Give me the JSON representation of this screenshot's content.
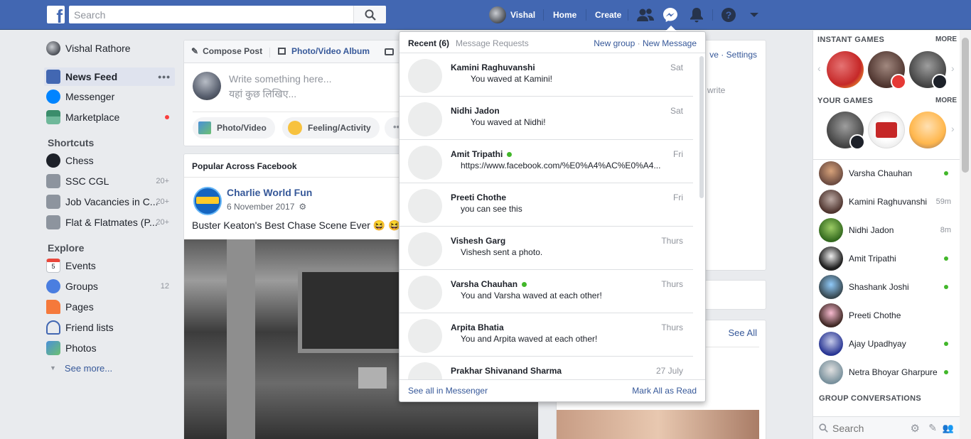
{
  "topbar": {
    "search_placeholder": "Search",
    "user_name": "Vishal",
    "home_label": "Home",
    "create_label": "Create"
  },
  "sidebar": {
    "profile_name": "Vishal Rathore",
    "main_items": [
      {
        "label": "News Feed",
        "icon": "news-feed-icon"
      },
      {
        "label": "Messenger",
        "icon": "messenger-icon"
      },
      {
        "label": "Marketplace",
        "icon": "marketplace-icon"
      }
    ],
    "shortcuts_title": "Shortcuts",
    "shortcuts": [
      {
        "label": "Chess",
        "count": ""
      },
      {
        "label": "SSC CGL",
        "count": "20+"
      },
      {
        "label": "Job Vacancies in C...",
        "count": "20+"
      },
      {
        "label": "Flat & Flatmates (P...",
        "count": "20+"
      }
    ],
    "explore_title": "Explore",
    "explore": [
      {
        "label": "Events",
        "count": ""
      },
      {
        "label": "Groups",
        "count": "12"
      },
      {
        "label": "Pages",
        "count": ""
      },
      {
        "label": "Friend lists",
        "count": ""
      },
      {
        "label": "Photos",
        "count": ""
      }
    ],
    "see_more": "See more..."
  },
  "composer": {
    "tab_compose": "Compose Post",
    "tab_album": "Photo/Video Album",
    "placeholder_en": "Write something here...",
    "placeholder_hi": "यहां कुछ लिखिए...",
    "btn_photo": "Photo/Video",
    "btn_feeling": "Feeling/Activity"
  },
  "feed": {
    "section_title": "Popular Across Facebook",
    "page_name": "Charlie World Fun",
    "post_date": "6 November 2017",
    "post_text": "Buster Keaton's Best Chase Scene Ever 😆 😆"
  },
  "right_partial": {
    "line1": "ve · Settings",
    "line2": "write",
    "see_all": "See All"
  },
  "messenger": {
    "tab_recent": "Recent",
    "recent_count": "(6)",
    "tab_requests": "Message Requests",
    "new_group": "New group",
    "dot": "·",
    "new_message": "New Message",
    "see_all": "See all in Messenger",
    "mark_all": "Mark All as Read",
    "messages": [
      {
        "name": "Kamini Raghuvanshi",
        "text": "You waved at Kamini!",
        "time": "Sat",
        "online": false,
        "indent": true
      },
      {
        "name": "Nidhi Jadon",
        "text": "You waved at Nidhi!",
        "time": "Sat",
        "online": false,
        "indent": true
      },
      {
        "name": "Amit Tripathi",
        "text": "https://www.facebook.com/%E0%A4%AC%E0%A4...",
        "time": "Fri",
        "online": true,
        "indent": false
      },
      {
        "name": "Preeti Chothe",
        "text": "you can see this",
        "time": "Fri",
        "online": false,
        "indent": false
      },
      {
        "name": "Vishesh Garg",
        "text": "Vishesh sent a photo.",
        "time": "Thurs",
        "online": false,
        "indent": false
      },
      {
        "name": "Varsha Chauhan",
        "text": "You and Varsha waved at each other!",
        "time": "Thurs",
        "online": true,
        "indent": false
      },
      {
        "name": "Arpita Bhatia",
        "text": "You and Arpita waved at each other!",
        "time": "Thurs",
        "online": false,
        "indent": false
      },
      {
        "name": "Prakhar Shivanand Sharma",
        "text": "",
        "time": "27 July",
        "online": false,
        "indent": false
      }
    ]
  },
  "chat": {
    "instant_games": "INSTANT GAMES",
    "your_games": "YOUR GAMES",
    "more": "MORE",
    "group_conversations": "GROUP CONVERSATIONS",
    "search_placeholder": "Search",
    "contacts": [
      {
        "name": "Varsha Chauhan",
        "status": "",
        "online": true
      },
      {
        "name": "Kamini Raghuvanshi",
        "status": "59m",
        "online": false
      },
      {
        "name": "Nidhi Jadon",
        "status": "8m",
        "online": false
      },
      {
        "name": "Amit Tripathi",
        "status": "",
        "online": true
      },
      {
        "name": "Shashank Joshi",
        "status": "",
        "online": true
      },
      {
        "name": "Preeti Chothe",
        "status": "",
        "online": false
      },
      {
        "name": "Ajay Upadhyay",
        "status": "",
        "online": true
      },
      {
        "name": "Netra Bhoyar Gharpure",
        "status": "",
        "online": true
      }
    ]
  },
  "colors": {
    "brand_blue": "#4267b2",
    "link_blue": "#365899",
    "online_green": "#42b72a",
    "notification_red": "#fa3e3e"
  }
}
